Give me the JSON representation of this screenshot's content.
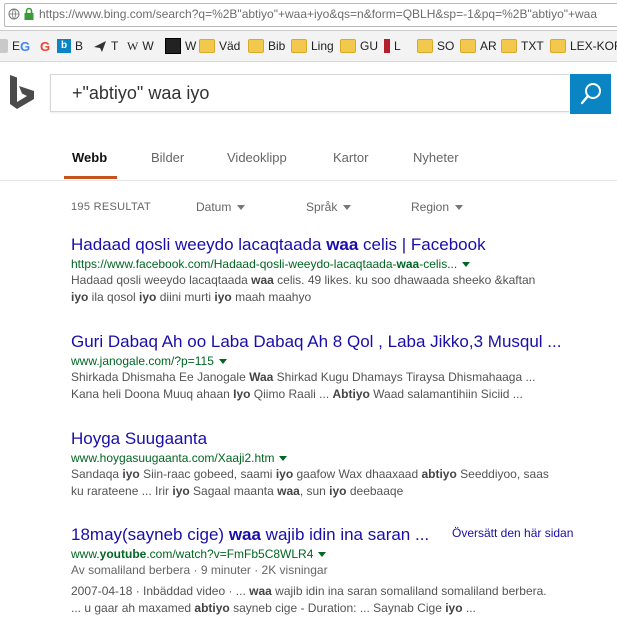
{
  "browser": {
    "url": "https://www.bing.com/search?q=%2B\"abtiyo\"+waa+iyo&qs=n&form=QBLH&sp=-1&pq=%2B\"abtiyo\"+waa",
    "bookmarks": [
      "E",
      "G",
      "G",
      "B",
      "T",
      "W",
      "W",
      "Väd",
      "Bib",
      "Ling",
      "GU",
      "L",
      "SO",
      "AR",
      "TXT",
      "LEX-KORP"
    ]
  },
  "search": {
    "query": "+\"abtiyo\" waa iyo"
  },
  "tabs": [
    "Webb",
    "Bilder",
    "Videoklipp",
    "Kartor",
    "Nyheter"
  ],
  "filters": {
    "results_count": "195 RESULTAT",
    "datum": "Datum",
    "sprak": "Språk",
    "region": "Region"
  },
  "results": [
    {
      "title_a": "Hadaad qosli weeydo lacaqtaada ",
      "title_b": "waa",
      "title_c": " celis | Facebook",
      "url": "https://www.facebook.com/Hadaad-qosli-weeydo-lacaqtaada-",
      "url_b": "waa",
      "url_c": "-celis...",
      "snip1_a": "Hadaad qosli weeydo lacaqtaada ",
      "snip1_b": "waa",
      "snip1_c": " celis. 49 likes. ku soo dhawaada sheeko &kaftan",
      "snip2_a": "iyo",
      "snip2_b": " ila qosol ",
      "snip2_c": "iyo",
      "snip2_d": " diini murti ",
      "snip2_e": "iyo",
      "snip2_f": " maah maahyo"
    },
    {
      "title": "Guri Dabaq Ah oo Laba Dabaq Ah 8 Qol , Laba Jikko,3 Musqul ...",
      "url": "www.janogale.com/?p=115",
      "snip1_a": "Shirkada Dhismaha Ee Janogale ",
      "snip1_b": "Waa",
      "snip1_c": " Shirkad Kugu Dhamays Tiraysa Dhismahaaga ...",
      "snip2_a": "Kana heli Doona Muuq ahaan ",
      "snip2_b": "Iyo",
      "snip2_c": " Qiimo Raali ... ",
      "snip2_d": "Abtiyo",
      "snip2_e": " Waad salamantihiin Siciid ..."
    },
    {
      "title": "Hoyga Suugaanta",
      "url": "www.hoygasuugaanta.com/Xaaji2.htm",
      "snip1_a": "Sandaqa ",
      "snip1_b": "iyo",
      "snip1_c": " Siin-raac gobeed, saami ",
      "snip1_d": "iyo",
      "snip1_e": " gaafow Wax dhaaxaad ",
      "snip1_f": "abtiyo",
      "snip1_g": " Seeddiyoo, saas",
      "snip2_a": "ku rarateene ... Irir ",
      "snip2_b": "iyo",
      "snip2_c": " Sagaal maanta ",
      "snip2_d": "waa",
      "snip2_e": ", sun ",
      "snip2_f": "iyo",
      "snip2_g": " deebaaqe"
    },
    {
      "title_a": "18may(sayneb cige) ",
      "title_b": "waa",
      "title_c": " wajib idin ina saran ...",
      "translate": "Översätt den här sidan",
      "url_a": "www.",
      "url_b": "youtube",
      "url_c": ".com/watch?v=FmFb5C8WLR4",
      "meta": "Av somaliland berbera · 9 minuter · 2K visningar",
      "snip1_a": "2007-04-18 · Inbäddad video · ... ",
      "snip1_b": "waa",
      "snip1_c": " wajib idin ina saran somaliland somaliland berbera.",
      "snip2_a": "... u gaar ah maxamed ",
      "snip2_b": "abtiyo",
      "snip2_c": " sayneb cige - Duration: ... Saynab Cige ",
      "snip2_d": "iyo",
      "snip2_e": " ..."
    }
  ]
}
